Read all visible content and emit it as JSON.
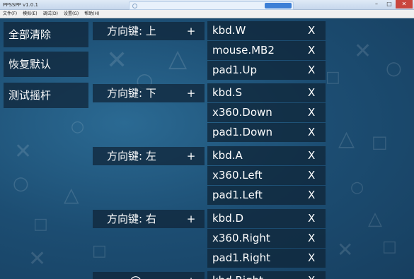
{
  "window": {
    "title": "PPSSPP v1.0.1",
    "minimize": "–",
    "maximize": "□",
    "close": "✕"
  },
  "menu": [
    "文件(F)",
    "模拟(E)",
    "调试(D)",
    "设置(G)",
    "帮助(H)"
  ],
  "left_buttons": [
    "全部清除",
    "恢复默认",
    "测试摇杆"
  ],
  "plus_label": "+",
  "remove_label": "X",
  "mappings": [
    {
      "key": "方向键: 上",
      "bindings": [
        "kbd.W",
        "mouse.MB2",
        "pad1.Up"
      ]
    },
    {
      "key": "方向键: 下",
      "bindings": [
        "kbd.S",
        "x360.Down",
        "pad1.Down"
      ]
    },
    {
      "key": "方向键: 左",
      "bindings": [
        "kbd.A",
        "x360.Left",
        "pad1.Left"
      ]
    },
    {
      "key": "方向键: 右",
      "bindings": [
        "kbd.D",
        "x360.Right",
        "pad1.Right"
      ]
    },
    {
      "key": "",
      "bindings": [
        "kbd.Right"
      ]
    }
  ]
}
